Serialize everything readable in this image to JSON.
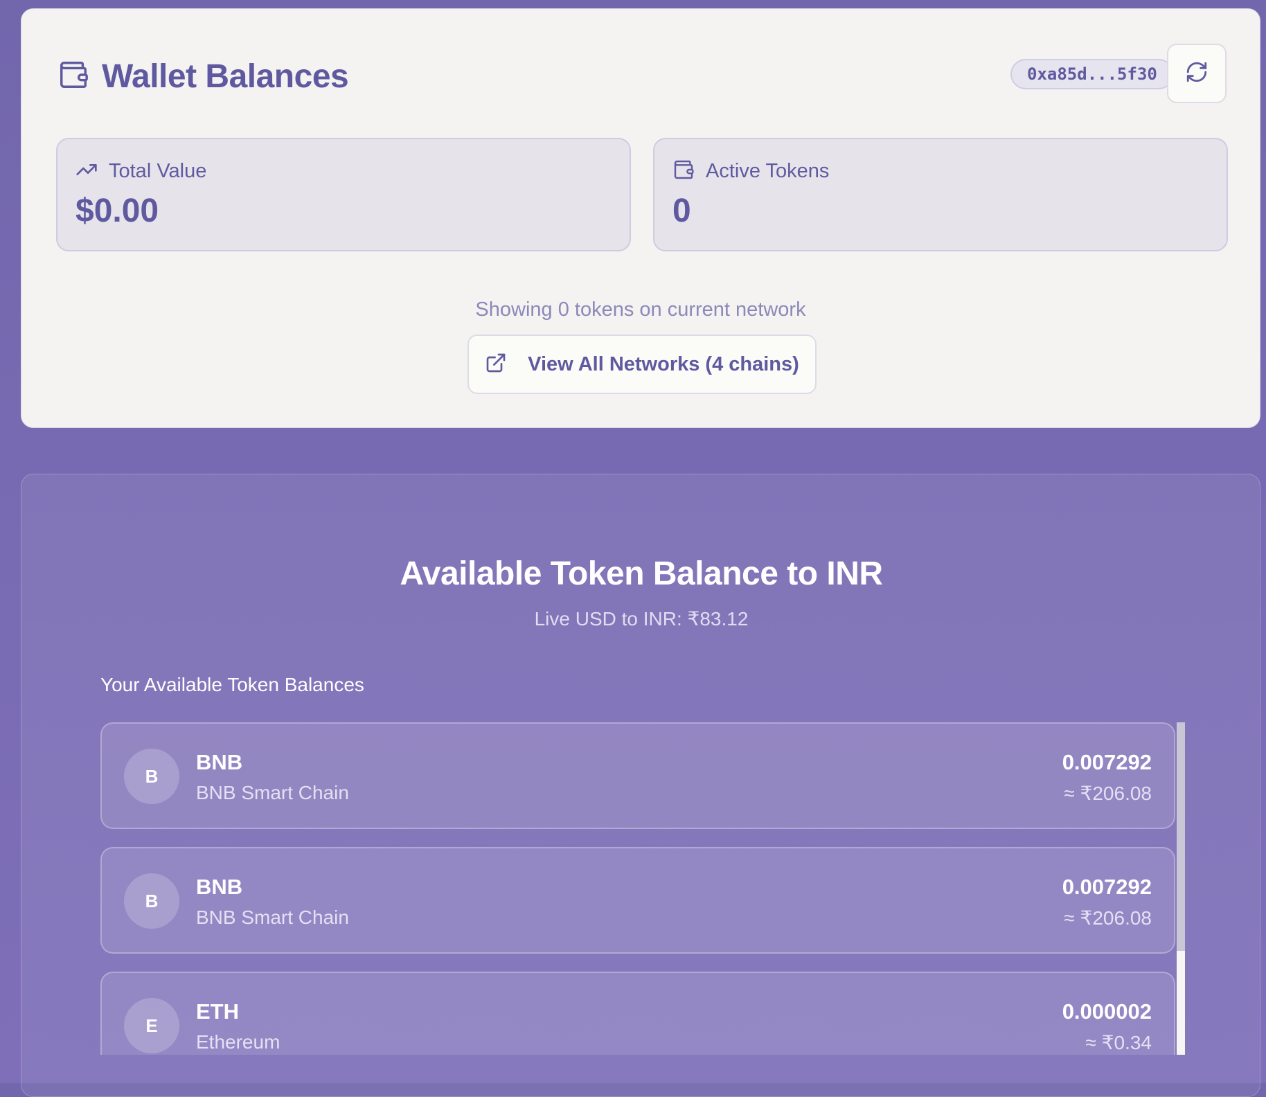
{
  "wallet": {
    "title": "Wallet Balances",
    "address": "0xa85d...5f30",
    "stats": {
      "total_value_label": "Total Value",
      "total_value": "$0.00",
      "active_tokens_label": "Active Tokens",
      "active_tokens": "0"
    },
    "showing_text": "Showing 0 tokens on current network",
    "view_all_label": "View All Networks (4 chains)"
  },
  "converter": {
    "title": "Available Token Balance to INR",
    "rate_text": "Live USD to INR: ₹83.12",
    "balances_label": "Your Available Token Balances",
    "tokens": [
      {
        "initial": "B",
        "symbol": "BNB",
        "network": "BNB Smart Chain",
        "amount": "0.007292",
        "inr": "≈ ₹206.08"
      },
      {
        "initial": "B",
        "symbol": "BNB",
        "network": "BNB Smart Chain",
        "amount": "0.007292",
        "inr": "≈ ₹206.08"
      },
      {
        "initial": "E",
        "symbol": "ETH",
        "network": "Ethereum",
        "amount": "0.000002",
        "inr": "≈ ₹0.34"
      }
    ]
  },
  "icons": {
    "wallet": "wallet-icon",
    "refresh": "refresh-icon",
    "trending": "trending-up-icon",
    "external": "external-link-icon"
  },
  "colors": {
    "accent": "#5f5aa0",
    "background": "#7266ad",
    "card": "#f4f3f2"
  }
}
